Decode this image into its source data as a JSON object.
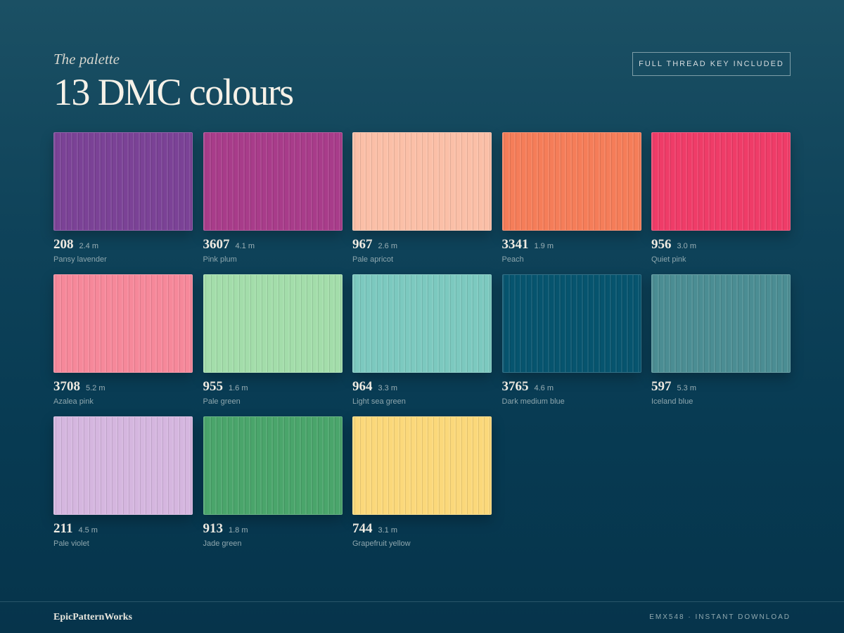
{
  "header": {
    "subtitle": "The palette",
    "title": "13 DMC colours"
  },
  "badge": {
    "label": "FULL THREAD KEY INCLUDED"
  },
  "swatches": [
    {
      "code": "208",
      "length": "2.4 m",
      "name": "Pansy lavender",
      "color": "#7b4296"
    },
    {
      "code": "3607",
      "length": "4.1 m",
      "name": "Pink plum",
      "color": "#a83c8a"
    },
    {
      "code": "967",
      "length": "2.6 m",
      "name": "Pale apricot",
      "color": "#fbbfa7"
    },
    {
      "code": "3341",
      "length": "1.9 m",
      "name": "Peach",
      "color": "#f57d59"
    },
    {
      "code": "956",
      "length": "3.0 m",
      "name": "Quiet pink",
      "color": "#ef3c68"
    },
    {
      "code": "3708",
      "length": "5.2 m",
      "name": "Azalea pink",
      "color": "#f6889a"
    },
    {
      "code": "955",
      "length": "1.6 m",
      "name": "Pale green",
      "color": "#a3ddaa"
    },
    {
      "code": "964",
      "length": "3.3 m",
      "name": "Light sea green",
      "color": "#7cc9bf"
    },
    {
      "code": "3765",
      "length": "4.6 m",
      "name": "Dark medium blue",
      "color": "#06546e"
    },
    {
      "code": "597",
      "length": "5.3 m",
      "name": "Iceland blue",
      "color": "#4b8d93"
    },
    {
      "code": "211",
      "length": "4.5 m",
      "name": "Pale violet",
      "color": "#d5b6df"
    },
    {
      "code": "913",
      "length": "1.8 m",
      "name": "Jade green",
      "color": "#4aa56b"
    },
    {
      "code": "744",
      "length": "3.1 m",
      "name": "Grapefruit yellow",
      "color": "#fbd87a"
    }
  ],
  "footer": {
    "brand": "EpicPatternWorks",
    "info": "EMX548 · INSTANT DOWNLOAD"
  }
}
